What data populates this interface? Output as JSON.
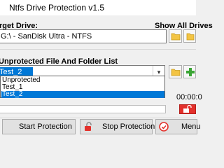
{
  "window": {
    "title": "Ntfs Drive Protection v1.5"
  },
  "target_drive": {
    "label": "Target Drive:",
    "show_all_label": "Show All Drives",
    "selected": "G:\\ - SanDisk Ultra - NTFS"
  },
  "unprotected": {
    "label": "Unprotected File And Folder List",
    "selected": "Test_2",
    "options": [
      "Unprotected",
      "Test_1",
      "Test_2"
    ]
  },
  "timer": {
    "value": "00:00:0"
  },
  "buttons": {
    "start": "Start Protection",
    "stop": "Stop Protection",
    "menu": "Menu"
  }
}
